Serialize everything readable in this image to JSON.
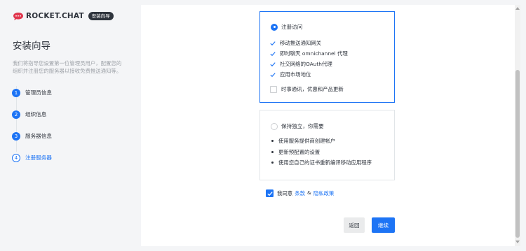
{
  "brand": {
    "name": "ROCKET.CHAT",
    "badge": "安装向导"
  },
  "sidebar": {
    "title": "安装向导",
    "description": "我们将指导您设置第一位管理员用户，配置您的组织并注册您的服务器以接收免费推送通知等。",
    "steps": [
      {
        "number": "1",
        "label": "管理员信息",
        "state": "done"
      },
      {
        "number": "2",
        "label": "组织信息",
        "state": "done"
      },
      {
        "number": "3",
        "label": "服务器信息",
        "state": "done"
      },
      {
        "number": "4",
        "label": "注册服务器",
        "state": "current"
      }
    ]
  },
  "register_option": {
    "label": "注册访问",
    "selected": true,
    "features": [
      "移动推送通知网关",
      "即时聊天 omnichannel 代理",
      "社交网络的OAuth代理",
      "应用市场地位"
    ],
    "newsletter_label": "时事通讯，优惠和产品更新",
    "newsletter_checked": false
  },
  "standalone_option": {
    "label": "保持独立，你需要",
    "selected": false,
    "requirements": [
      "使用服务提供商创建帐户",
      "更新预配置的设置",
      "使用您自己的证书重新编译移动应用程序"
    ]
  },
  "agreement": {
    "checked": true,
    "prefix": "我同意",
    "terms_link": "条款",
    "connector": "&",
    "privacy_link": "隐私政策"
  },
  "buttons": {
    "back": "返回",
    "continue": "继续"
  },
  "colors": {
    "accent": "#1d74f5",
    "text": "#2f343d",
    "muted": "#9ea2a8",
    "logo_red": "#e0364d"
  }
}
